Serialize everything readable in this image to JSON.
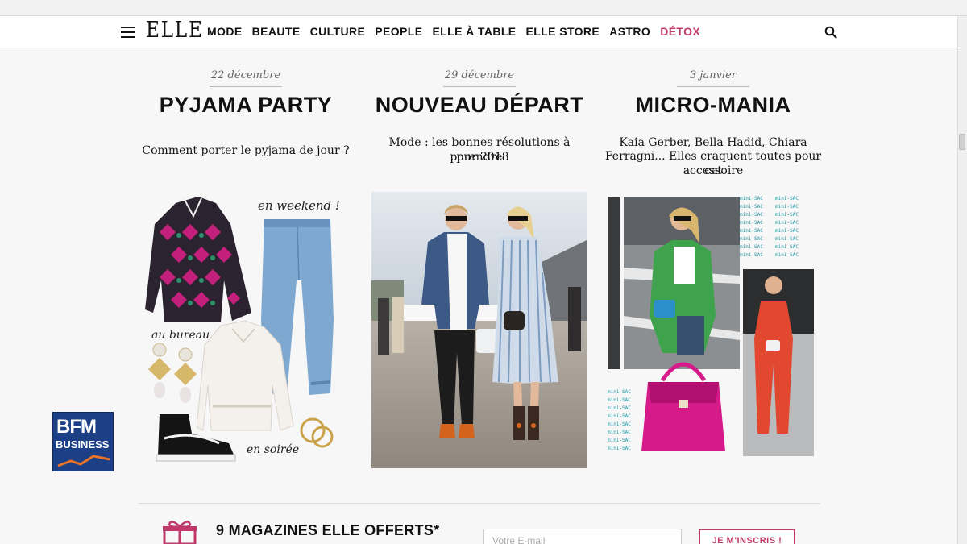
{
  "nav": {
    "logo": "ELLE",
    "items": [
      {
        "label": "MODE",
        "name": "nav-item-mode",
        "accent": false
      },
      {
        "label": "BEAUTE",
        "name": "nav-item-beaute",
        "accent": false
      },
      {
        "label": "CULTURE",
        "name": "nav-item-culture",
        "accent": false
      },
      {
        "label": "PEOPLE",
        "name": "nav-item-people",
        "accent": false
      },
      {
        "label": "ELLE À TABLE",
        "name": "nav-item-elle-a-table",
        "accent": false
      },
      {
        "label": "ELLE STORE",
        "name": "nav-item-elle-store",
        "accent": false
      },
      {
        "label": "ASTRO",
        "name": "nav-item-astro",
        "accent": false
      },
      {
        "label": "DÉTOX",
        "name": "nav-item-detox",
        "accent": true
      }
    ],
    "menu_icon": "hamburger-icon",
    "search_icon": "search-icon",
    "accent_color": "#c0396b"
  },
  "articles": [
    {
      "date": "22 décembre",
      "title": "PYJAMA PARTY",
      "desc_lines": [
        "Comment porter le pyjama de jour ?"
      ],
      "annotations": [
        "en weekend !",
        "au bureau",
        "en soirée"
      ]
    },
    {
      "date": "29 décembre",
      "title": "NOUVEAU DÉPART",
      "desc_lines": [
        "Mode : les bonnes résolutions à prendre",
        "pour 2018"
      ]
    },
    {
      "date": "3 janvier",
      "title": "MICRO-MANIA",
      "desc_lines": [
        "Kaia Gerber, Bella Hadid, Chiara",
        "Ferragni... Elles craquent toutes pour cet",
        "accessoire"
      ],
      "pattern_text": "mini-SAC"
    }
  ],
  "watermark": {
    "line1": "BFM",
    "line2": "BUSINESS"
  },
  "newsletter": {
    "title": "9 MAGAZINES ELLE OFFERTS*",
    "email_placeholder": "Votre E-mail",
    "button_label": "JE M'INSCRIS !",
    "gift_icon": "gift-icon"
  }
}
